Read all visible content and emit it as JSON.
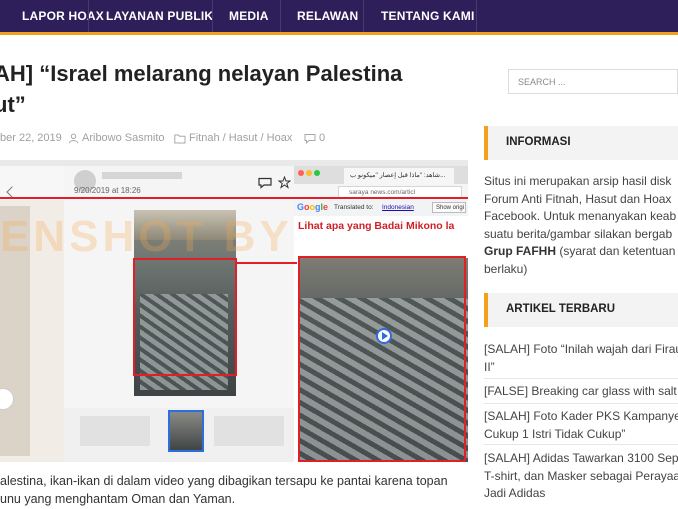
{
  "nav": {
    "items": [
      "LAPOR HOAX",
      "LAYANAN PUBLIK",
      "MEDIA",
      "RELAWAN",
      "TENTANG KAMI"
    ],
    "bg_color": "#2e1f5a",
    "accent_color": "#f2a11c"
  },
  "article": {
    "title_lines": [
      "AH] “Israel melarang nelayan Palestina",
      "ut”"
    ],
    "meta": {
      "date": "ber 22, 2019",
      "author": "Aribowo Sasmito",
      "categories": "Fitnah / Hasut / Hoax",
      "comments": "0"
    },
    "image": {
      "screenshot_date": "9/20/2019 at 18:26",
      "tab_title": "شاهد: \"ماذا قبل إعصار \"ميكونو ب...",
      "url": "saraya news.com/articl",
      "translate_label": "Translated to:",
      "translate_language": "Indonesian",
      "translate_button": "Show origi",
      "headline_fragment": "Lihat apa yang Badai Mikono la",
      "watermark": "ENSHOT BY"
    },
    "caption_lines": [
      "alestina, ikan-ikan di dalam video yang dibagikan tersapu ke pantai karena topan",
      "unu yang menghantam Oman dan Yaman."
    ]
  },
  "sidebar": {
    "search_placeholder": "SEARCH ...",
    "informasi": {
      "heading": "INFORMASI",
      "lines": [
        "Situs ini merupakan arsip hasil disk",
        "Forum Anti Fitnah, Hasut dan Hoax",
        "Facebook. Untuk menanyakan keab",
        "suatu berita/gambar silakan bergab"
      ],
      "bold_prefix": "Grup FAFHH",
      "line5_rest": " (syarat dan ketentuan p",
      "line6": "berlaku)"
    },
    "artikel": {
      "heading": "ARTIKEL TERBARU",
      "items": [
        [
          "[SALAH] Foto “Inilah wajah dari Firau",
          "II”"
        ],
        [
          "[FALSE] Breaking car glass with salt a"
        ],
        [
          "[SALAH] Foto Kader PKS Kampanyeka",
          "Cukup 1 Istri Tidak Cukup”"
        ],
        [
          "[SALAH] Adidas Tawarkan 3100 Sepa",
          "T-shirt, dan Masker sebagai Perayaa",
          "Jadi Adidas"
        ]
      ]
    }
  }
}
